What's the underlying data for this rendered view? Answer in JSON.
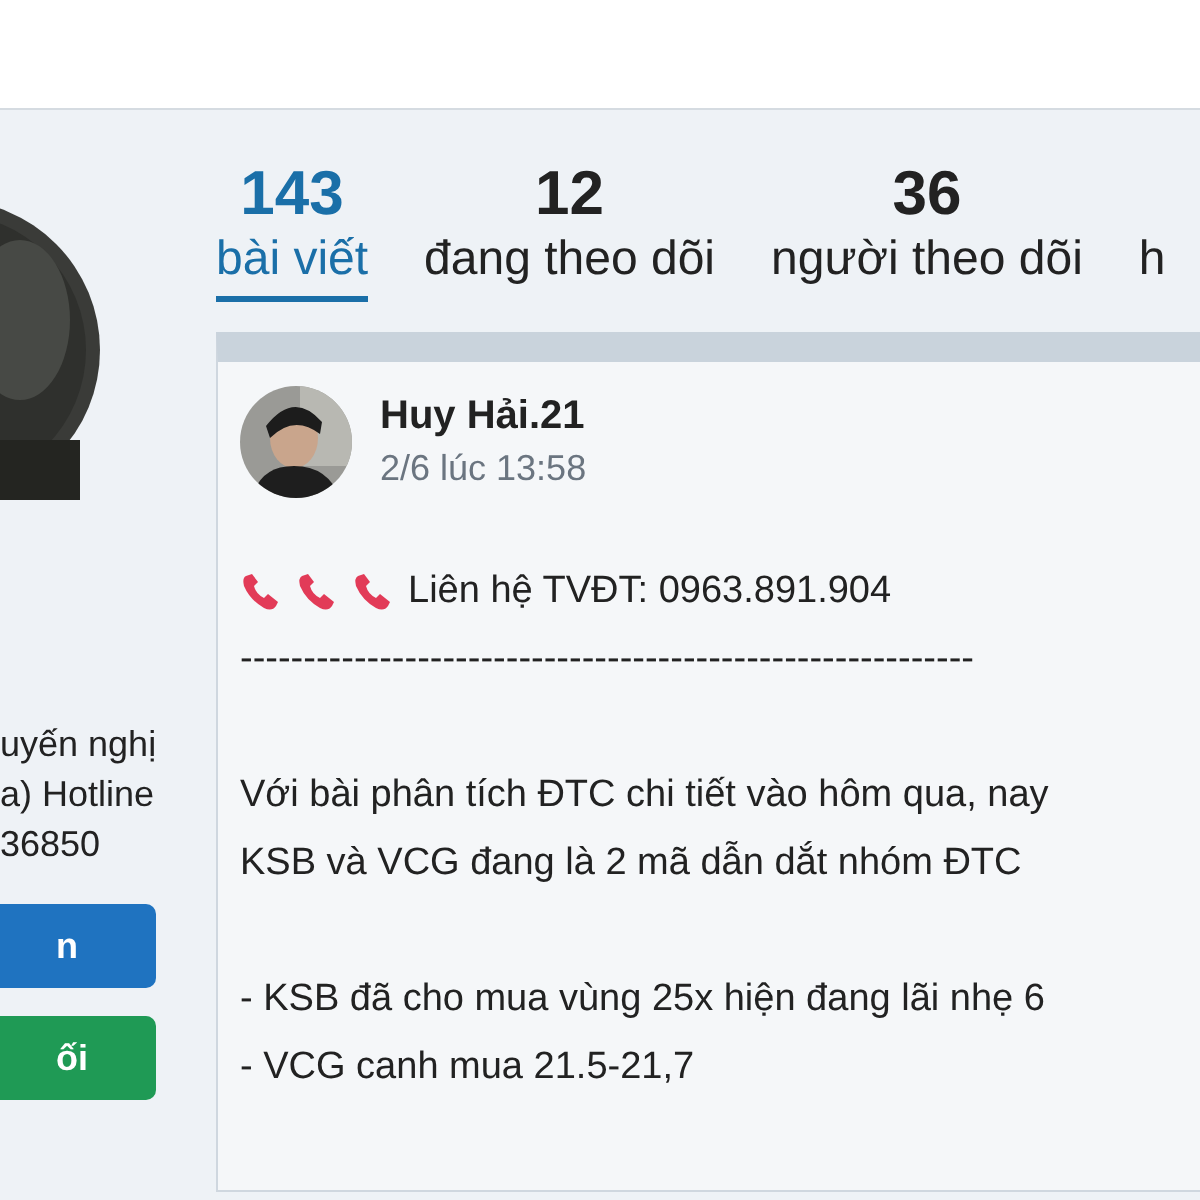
{
  "profile": {
    "bio_lines": [
      "uyến nghị",
      "a) Hotline",
      "36850"
    ],
    "buttons": [
      {
        "label": "n",
        "kind": "primary"
      },
      {
        "label": "ối",
        "kind": "success"
      }
    ]
  },
  "stats": [
    {
      "count": "143",
      "label": "bài viết",
      "selected": true
    },
    {
      "count": "12",
      "label": "đang theo dõi",
      "selected": false
    },
    {
      "count": "36",
      "label": "người theo dõi",
      "selected": false
    },
    {
      "label": "h",
      "selected": false
    }
  ],
  "post": {
    "author": "Huy Hải.21",
    "time": "2/6 lúc 13:58",
    "contact": "Liên hệ TVĐT: 0963.891.904",
    "paragraphs": [
      [
        "----------------------------------------------------------"
      ],
      [
        "Với bài phân tích ĐTC chi tiết vào hôm qua, nay",
        "KSB và VCG đang là 2 mã dẫn dắt nhóm ĐTC"
      ],
      [
        "- KSB đã cho mua vùng 25x hiện đang lãi nhẹ 6",
        "- VCG canh mua 21.5-21,7"
      ]
    ]
  }
}
